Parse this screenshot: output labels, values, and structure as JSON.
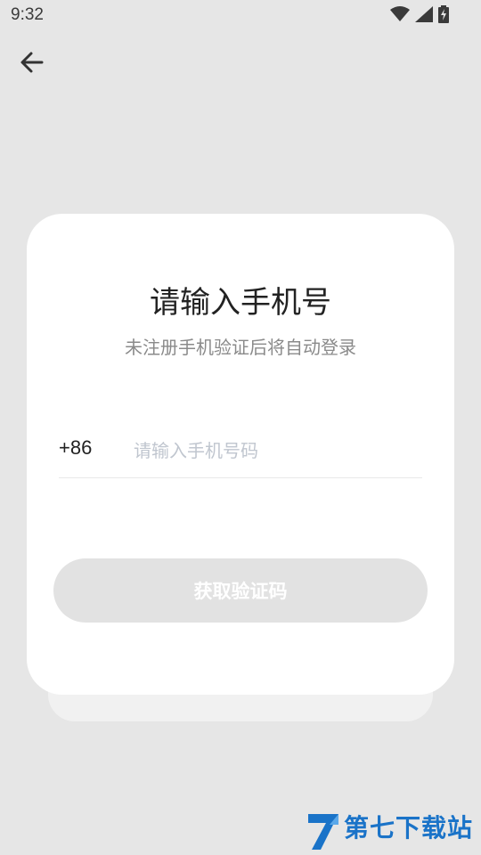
{
  "status_bar": {
    "time": "9:32"
  },
  "nav": {
    "back_icon": "arrow-left-icon"
  },
  "login": {
    "title": "请输入手机号",
    "subtitle": "未注册手机验证后将自动登录",
    "country_code": "+86",
    "phone_placeholder": "请输入手机号码",
    "phone_value": "",
    "get_code_label": "获取验证码"
  },
  "watermark": {
    "text": "第七下载站"
  },
  "colors": {
    "background": "#e6e6e6",
    "card": "#ffffff",
    "button_disabled": "#e2e2e2",
    "placeholder": "#c0c6cf"
  }
}
